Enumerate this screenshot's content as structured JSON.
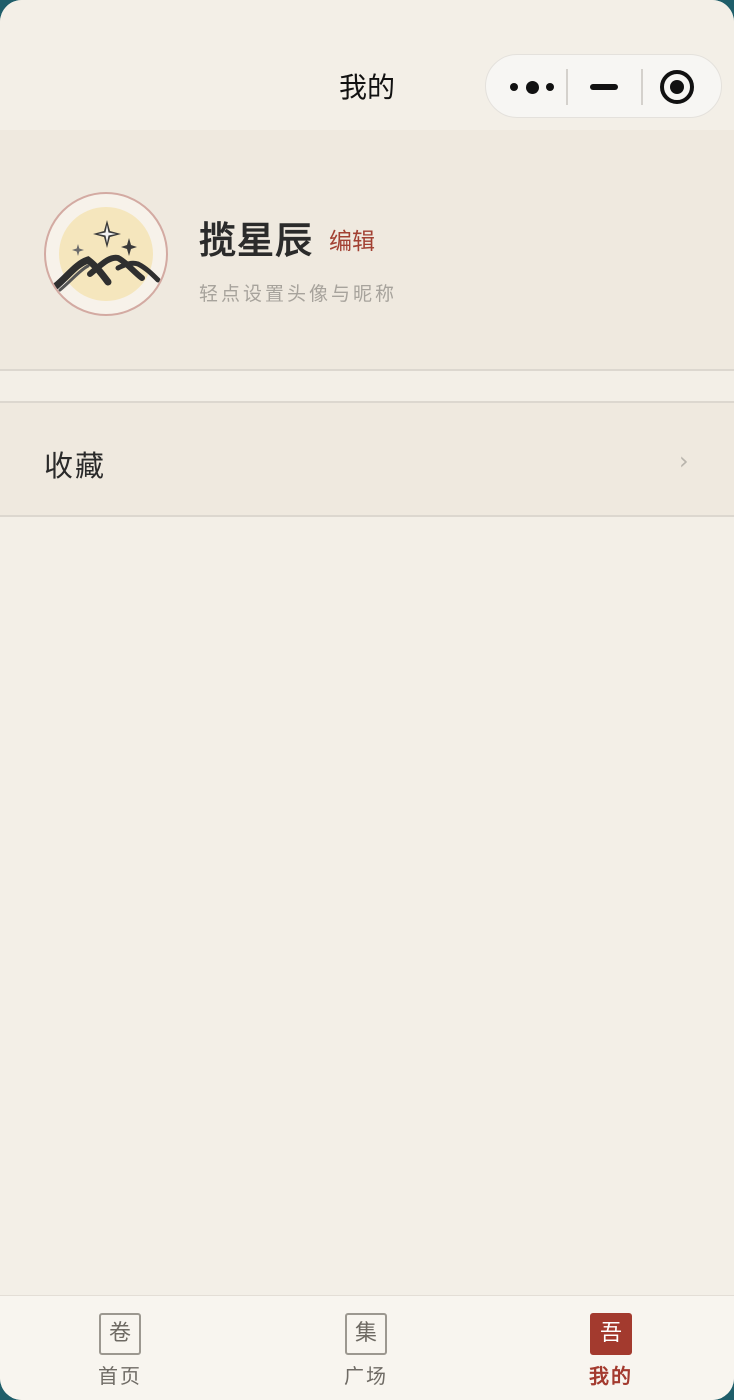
{
  "header": {
    "title": "我的"
  },
  "capsule": {
    "more_icon": "more-dots-icon",
    "minimize_icon": "minimize-icon",
    "close_icon": "target-close-icon"
  },
  "profile": {
    "nickname": "揽星辰",
    "edit_label": "编辑",
    "hint": "轻点设置头像与昵称",
    "avatar_icon": "stars-over-mountains-icon"
  },
  "menu": {
    "favorites_label": "收藏",
    "chevron": "›"
  },
  "tabbar": {
    "active": "mine",
    "tabs": [
      {
        "key": "home",
        "icon_char": "卷",
        "label": "首页"
      },
      {
        "key": "plaza",
        "icon_char": "集",
        "label": "广场"
      },
      {
        "key": "mine",
        "icon_char": "吾",
        "label": "我的"
      }
    ]
  },
  "colors": {
    "accent": "#a33a2e",
    "background": "#f3efe7",
    "panel": "#efe9df"
  }
}
